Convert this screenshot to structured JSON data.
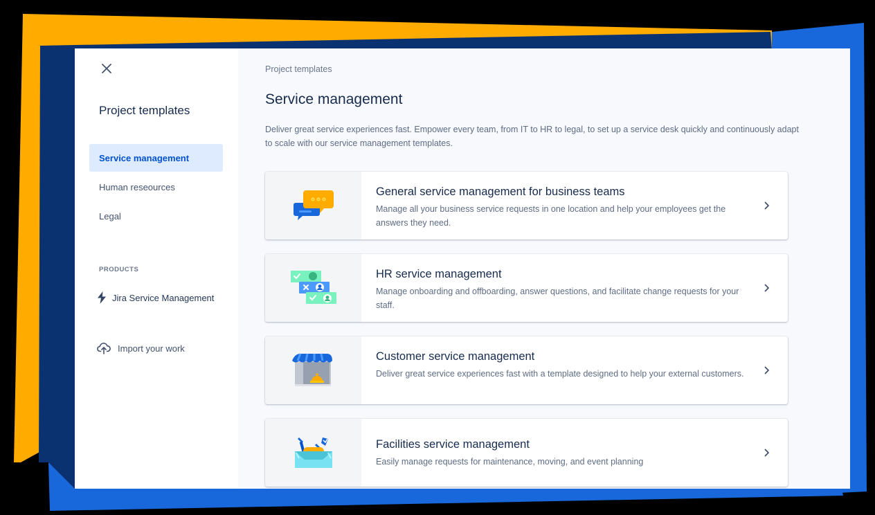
{
  "sidebar": {
    "title": "Project templates",
    "items": [
      {
        "label": "Service management",
        "active": true
      },
      {
        "label": "Human reseources",
        "active": false
      },
      {
        "label": "Legal",
        "active": false
      }
    ],
    "products_heading": "PRODUCTS",
    "product_label": "Jira Service Management",
    "import_label": "Import your work"
  },
  "main": {
    "breadcrumb": "Project templates",
    "title": "Service management",
    "description": "Deliver great service experiences fast. Empower every team, from IT to HR to legal, to set up a service desk quickly and continuously adapt to scale with our service management templates.",
    "cards": [
      {
        "title": "General service management for business teams",
        "description": "Manage all your business service requests in one location and help your employees get the answers they need.",
        "icon": "chat-bubbles-icon"
      },
      {
        "title": "HR service management",
        "description": "Manage onboarding and offboarding, answer questions, and facilitate change requests for your staff.",
        "icon": "hr-cards-icon"
      },
      {
        "title": "Customer service management",
        "description": "Deliver great service experiences fast with a template designed to help your external customers.",
        "icon": "storefront-icon"
      },
      {
        "title": "Facilities service management",
        "description": "Easily manage requests for maintenance, moving, and event planning",
        "icon": "toolbox-icon"
      }
    ]
  },
  "colors": {
    "accent": "#0052CC",
    "active_bg": "#DEEBFF",
    "frame_orange": "#FFAB00",
    "frame_navy": "#0B3270",
    "frame_blue": "#1868DB"
  }
}
